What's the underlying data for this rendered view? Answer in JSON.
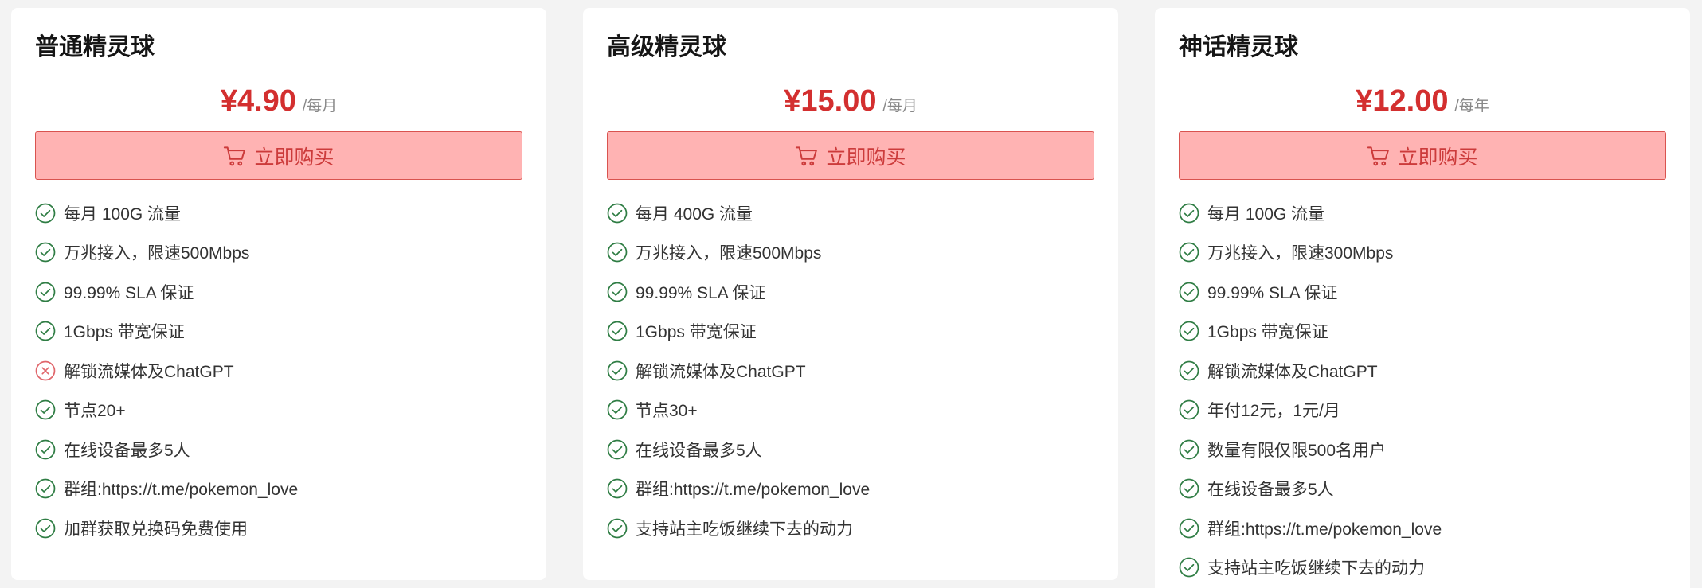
{
  "colors": {
    "price": "#d32f2f",
    "button_background": "#ffb3b3",
    "button_border": "#d9534f",
    "button_text": "#cc3b3b",
    "included_icon": "#2f7d44",
    "excluded_icon": "#e0666b"
  },
  "icons": {
    "buy": "cart-icon",
    "included": "check-circle-icon",
    "excluded": "x-circle-icon"
  },
  "plans": [
    {
      "name": "普通精灵球",
      "price": "¥4.90",
      "period": "/每月",
      "buy_label": "立即购买",
      "features": [
        {
          "text": "每月 100G 流量",
          "included": true
        },
        {
          "text": "万兆接入，限速500Mbps",
          "included": true
        },
        {
          "text": "99.99% SLA 保证",
          "included": true
        },
        {
          "text": "1Gbps 带宽保证",
          "included": true
        },
        {
          "text": "解锁流媒体及ChatGPT",
          "included": false
        },
        {
          "text": "节点20+",
          "included": true
        },
        {
          "text": "在线设备最多5人",
          "included": true
        },
        {
          "text": "群组:https://t.me/pokemon_love",
          "included": true
        },
        {
          "text": "加群获取兑换码免费使用",
          "included": true
        }
      ]
    },
    {
      "name": "高级精灵球",
      "price": "¥15.00",
      "period": "/每月",
      "buy_label": "立即购买",
      "features": [
        {
          "text": "每月 400G 流量",
          "included": true
        },
        {
          "text": "万兆接入，限速500Mbps",
          "included": true
        },
        {
          "text": "99.99% SLA 保证",
          "included": true
        },
        {
          "text": "1Gbps 带宽保证",
          "included": true
        },
        {
          "text": "解锁流媒体及ChatGPT",
          "included": true
        },
        {
          "text": "节点30+",
          "included": true
        },
        {
          "text": "在线设备最多5人",
          "included": true
        },
        {
          "text": "群组:https://t.me/pokemon_love",
          "included": true
        },
        {
          "text": "支持站主吃饭继续下去的动力",
          "included": true
        }
      ]
    },
    {
      "name": "神话精灵球",
      "price": "¥12.00",
      "period": "/每年",
      "buy_label": "立即购买",
      "features": [
        {
          "text": "每月 100G 流量",
          "included": true
        },
        {
          "text": "万兆接入，限速300Mbps",
          "included": true
        },
        {
          "text": "99.99% SLA 保证",
          "included": true
        },
        {
          "text": "1Gbps 带宽保证",
          "included": true
        },
        {
          "text": "解锁流媒体及ChatGPT",
          "included": true
        },
        {
          "text": "年付12元，1元/月",
          "included": true
        },
        {
          "text": "数量有限仅限500名用户",
          "included": true
        },
        {
          "text": "在线设备最多5人",
          "included": true
        },
        {
          "text": "群组:https://t.me/pokemon_love",
          "included": true
        },
        {
          "text": "支持站主吃饭继续下去的动力",
          "included": true
        }
      ]
    }
  ]
}
